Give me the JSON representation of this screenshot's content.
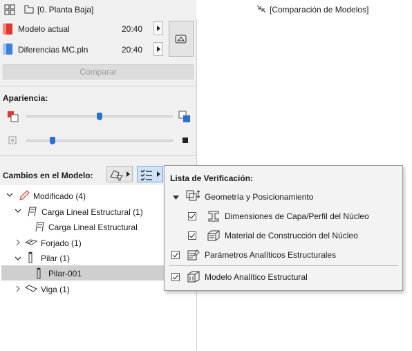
{
  "header": {
    "view_label": "[0. Planta Baja]",
    "compare_tab_label": "[Comparación de Modelos]"
  },
  "models": [
    {
      "name": "Modelo actual",
      "time": "20:40",
      "color": "#e8342a"
    },
    {
      "name": "Diferencias MC.pln",
      "time": "20:40",
      "color": "#3b82e0"
    }
  ],
  "compare_button": "Comparar",
  "appearance": {
    "label": "Apariencia:",
    "slider1_value": 0.5,
    "slider2_value": 0.18,
    "accent": "#2a6fd6"
  },
  "changes": {
    "label": "Cambios en el Modelo:"
  },
  "tree": [
    {
      "label": "Modificado (4)"
    },
    {
      "label": "Carga Lineal Estructural (1)"
    },
    {
      "label": "Carga Lineal Estructural"
    },
    {
      "label": "Forjado (1)"
    },
    {
      "label": "Pilar (1)"
    },
    {
      "label": "Pilar-001"
    },
    {
      "label": "Viga (1)"
    }
  ],
  "checklist": {
    "title": "Lista de Verificación:",
    "group": "Geometría y Posicionamiento",
    "items": [
      {
        "label": "Dimensiones de Capa/Perfil del Núcleo",
        "checked": true
      },
      {
        "label": "Material de Construcción del Núcleo",
        "checked": true
      },
      {
        "label": "Parámetros Analíticos Estructurales",
        "checked": true
      },
      {
        "label": "Modelo Analítico Estructural",
        "checked": true
      }
    ]
  }
}
